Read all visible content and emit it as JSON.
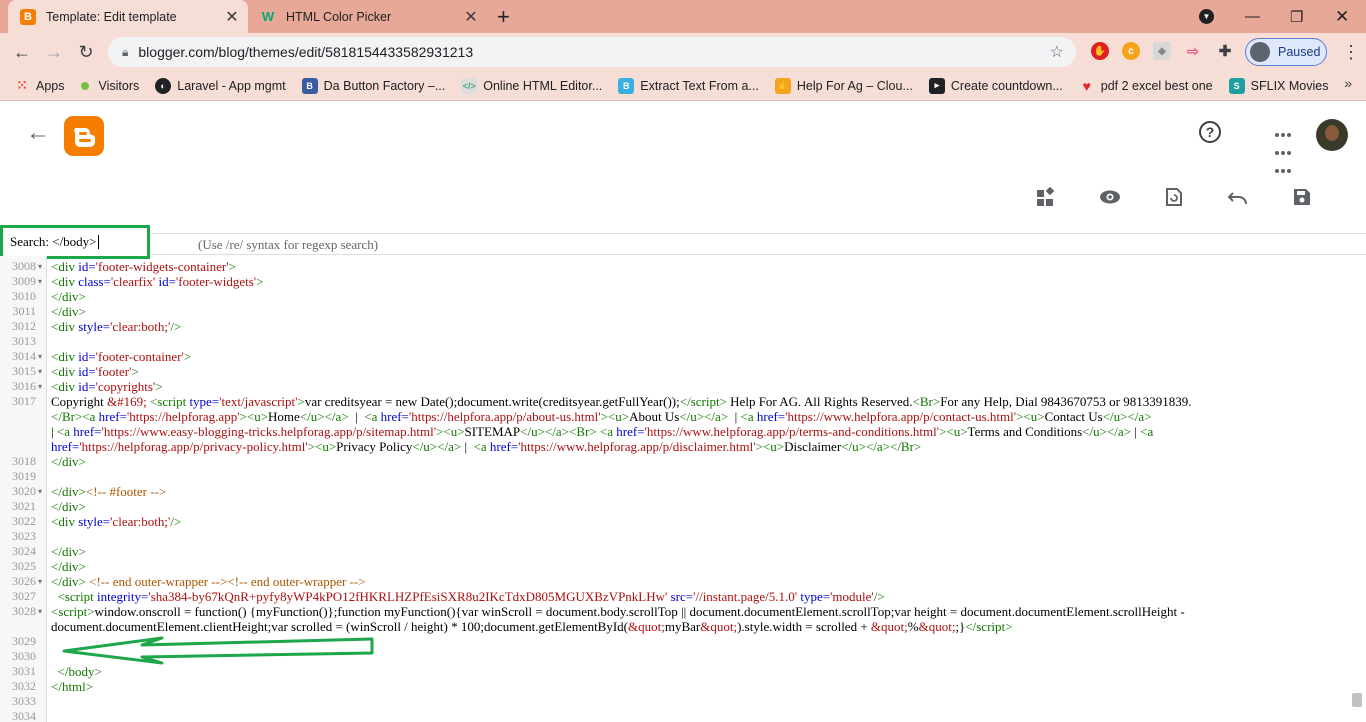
{
  "browser": {
    "tabs": [
      {
        "title": "Template: Edit template",
        "favicon": "blogger-icon",
        "color": "#f57d00"
      },
      {
        "title": "HTML Color Picker",
        "favicon": "w3schools-icon",
        "color": "#04aa6d"
      }
    ],
    "url": "blogger.com/blog/themes/edit/5818154433582931213",
    "profile_status": "Paused",
    "bookmarks": [
      "Apps",
      "Visitors",
      "Laravel - App mgmt",
      "Da Button Factory –...",
      "Online HTML Editor...",
      "Extract Text From a...",
      "Help For Ag – Clou...",
      "Create countdown...",
      "pdf 2 excel best one",
      "SFLIX Movies"
    ],
    "more": "»"
  },
  "editor": {
    "search_label": "Search:",
    "search_value": "</body>",
    "search_hint": "(Use /re/ syntax for regexp search)",
    "lines": [
      {
        "n": "3008",
        "fold": true,
        "html": "<span class='tg'>&lt;div</span> <span class='at'>id=</span><span class='st'>'footer-widgets-container'</span><span class='tg'>&gt;</span>"
      },
      {
        "n": "3009",
        "fold": true,
        "html": "<span class='tg'>&lt;div</span> <span class='at'>class=</span><span class='st'>'clearfix'</span> <span class='at'>id=</span><span class='st'>'footer-widgets'</span><span class='tg'>&gt;</span>"
      },
      {
        "n": "3010",
        "html": "<span class='tg'>&lt;/div&gt;</span>"
      },
      {
        "n": "3011",
        "html": "<span class='tg'>&lt;/div&gt;</span>"
      },
      {
        "n": "3012",
        "html": "<span class='tg'>&lt;div</span> <span class='at'>style=</span><span class='st'>'clear:both;'</span><span class='tg'>/&gt;</span>"
      },
      {
        "n": "3013",
        "html": ""
      },
      {
        "n": "3014",
        "fold": true,
        "html": "<span class='tg'>&lt;div</span> <span class='at'>id=</span><span class='st'>'footer-container'</span><span class='tg'>&gt;</span>"
      },
      {
        "n": "3015",
        "fold": true,
        "html": "<span class='tg'>&lt;div</span> <span class='at'>id=</span><span class='st'>'footer'</span><span class='tg'>&gt;</span>"
      },
      {
        "n": "3016",
        "fold": true,
        "html": "<span class='tg'>&lt;div</span> <span class='at'>id=</span><span class='st'>'copyrights'</span><span class='tg'>&gt;</span>"
      },
      {
        "n": "3017",
        "html": "Copyright <span class='st'>&amp;#169;</span> <span class='tg'>&lt;script</span> <span class='at'>type=</span><span class='st'>'text/javascript'</span><span class='tg'>&gt;</span>var creditsyear = new Date();document.write(creditsyear.getFullYear());<span class='tg'>&lt;/script&gt;</span> Help For AG. All Rights Reserved.<span class='tg'>&lt;Br&gt;</span>For any Help, Dial 9843670753 or 9813391839."
      },
      {
        "n": "",
        "html": "<span class='tg'>&lt;/Br&gt;&lt;a</span> <span class='at'>href=</span><span class='st'>'https://helpforag.app'</span><span class='tg'>&gt;&lt;u&gt;</span>Home<span class='tg'>&lt;/u&gt;&lt;/a&gt;</span>&nbsp; | &nbsp;<span class='tg'>&lt;a</span> <span class='at'>href=</span><span class='st'>'https://helpfora.app/p/about-us.html'</span><span class='tg'>&gt;&lt;u&gt;</span>About Us<span class='tg'>&lt;/u&gt;&lt;/a&gt;</span>&nbsp; | <span class='tg'>&lt;a</span> <span class='at'>href=</span><span class='st'>'https://www.helpfora.app/p/contact-us.html'</span><span class='tg'>&gt;&lt;u&gt;</span>Contact Us<span class='tg'>&lt;/u&gt;&lt;/a&gt;</span>"
      },
      {
        "n": "",
        "html": "| <span class='tg'>&lt;a</span> <span class='at'>href=</span><span class='st'>'https://www.easy-blogging-tricks.helpforag.app/p/sitemap.html'</span><span class='tg'>&gt;&lt;u&gt;</span>SITEMAP<span class='tg'>&lt;/u&gt;&lt;/a&gt;&lt;Br&gt;</span> <span class='tg'>&lt;a</span> <span class='at'>href=</span><span class='st'>'https://www.helpforag.app/p/terms-and-conditions.html'</span><span class='tg'>&gt;&lt;u&gt;</span>Terms and Conditions<span class='tg'>&lt;/u&gt;&lt;/a&gt;</span> | <span class='tg'>&lt;a</span>"
      },
      {
        "n": "",
        "html": "<span class='at'>href=</span><span class='st'>'https://helpforag.app/p/privacy-policy.html'</span><span class='tg'>&gt;&lt;u&gt;</span>Privacy Policy<span class='tg'>&lt;/u&gt;&lt;/a&gt;</span> | &nbsp;<span class='tg'>&lt;a</span> <span class='at'>href=</span><span class='st'>'https://www.helpforag.app/p/disclaimer.html'</span><span class='tg'>&gt;&lt;u&gt;</span>Disclaimer<span class='tg'>&lt;/u&gt;&lt;/a&gt;&lt;/Br&gt;</span>"
      },
      {
        "n": "3018",
        "html": "<span class='tg'>&lt;/div&gt;</span>"
      },
      {
        "n": "3019",
        "html": ""
      },
      {
        "n": "3020",
        "fold": true,
        "html": "<span class='tg'>&lt;/div&gt;</span><span class='cm'>&lt;!-- #footer --&gt;</span>"
      },
      {
        "n": "3021",
        "html": "<span class='tg'>&lt;/div&gt;</span>"
      },
      {
        "n": "3022",
        "html": "<span class='tg'>&lt;div</span> <span class='at'>style=</span><span class='st'>'clear:both;'</span><span class='tg'>/&gt;</span>"
      },
      {
        "n": "3023",
        "html": ""
      },
      {
        "n": "3024",
        "html": "<span class='tg'>&lt;/div&gt;</span>"
      },
      {
        "n": "3025",
        "html": "<span class='tg'>&lt;/div&gt;</span>"
      },
      {
        "n": "3026",
        "fold": true,
        "html": "<span class='tg'>&lt;/div&gt;</span> <span class='cm'>&lt;!-- end outer-wrapper --&gt;&lt;!-- end outer-wrapper --&gt;</span>"
      },
      {
        "n": "3027",
        "html": "&nbsp;&nbsp;<span class='tg'>&lt;script</span> <span class='at'>integrity=</span><span class='st'>'sha384-by67kQnR+pyfy8yWP4kPO12fHKRLHZPfEsiSXR8u2IKcTdxD805MGUXBzVPnkLHw'</span> <span class='at'>src=</span><span class='st'>'//instant.page/5.1.0'</span> <span class='at'>type=</span><span class='st'>'module'</span><span class='tg'>/&gt;</span>"
      },
      {
        "n": "3028",
        "fold": true,
        "html": "<span class='tg'>&lt;script&gt;</span>window.onscroll = function() {myFunction()};function myFunction(){var winScroll = document.body.scrollTop || document.documentElement.scrollTop;var height = document.documentElement.scrollHeight -"
      },
      {
        "n": "",
        "html": "document.documentElement.clientHeight;var scrolled = (winScroll / height) * 100;document.getElementById(<span class='st'>&amp;quot;</span>myBar<span class='st'>&amp;quot;</span>).style.width = scrolled + <span class='st'>&amp;quot;</span>%<span class='st'>&amp;quot;</span>;}<span class='tg'>&lt;/script&gt;</span>"
      },
      {
        "n": "3029",
        "html": ""
      },
      {
        "n": "3030",
        "html": ""
      },
      {
        "n": "3031",
        "html": "&nbsp;&nbsp;<span class='tg'>&lt;/body&gt;</span>"
      },
      {
        "n": "3032",
        "html": "<span class='tg'>&lt;/html&gt;</span>"
      },
      {
        "n": "3033",
        "html": ""
      },
      {
        "n": "3034",
        "html": ""
      }
    ]
  },
  "colors": {
    "highlight": "#1ea64a",
    "blogger_orange": "#f57d00"
  }
}
